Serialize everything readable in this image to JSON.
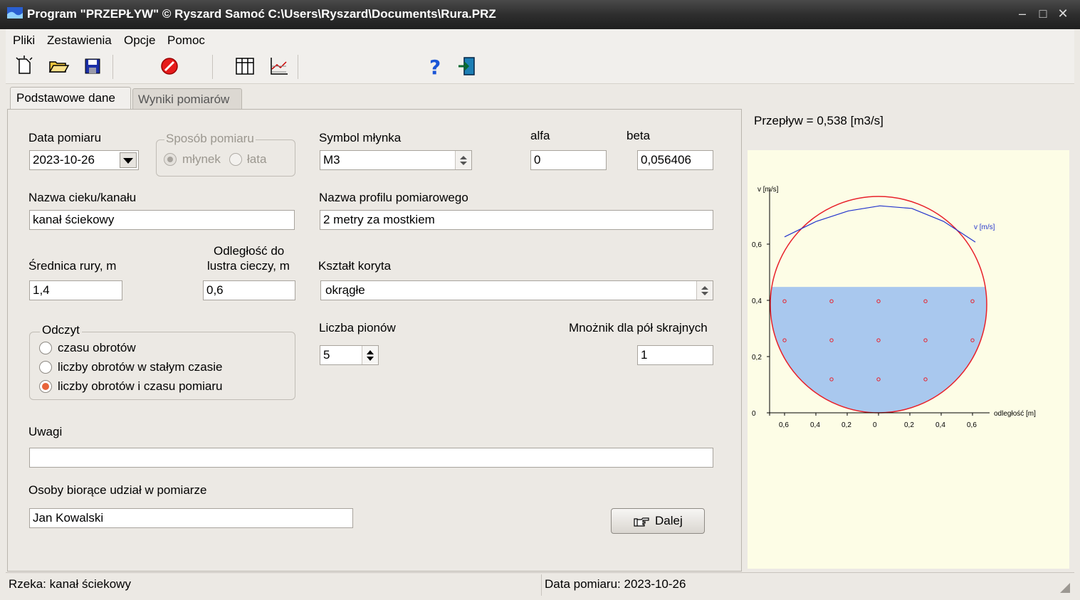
{
  "window": {
    "title": "Program \"PRZEPŁYW\" © Ryszard Samoć  C:\\Users\\Ryszard\\Documents\\Rura.PRZ"
  },
  "menu": [
    "Pliki",
    "Zestawienia",
    "Opcje",
    "Pomoc"
  ],
  "toolbar": [
    "new-icon",
    "open-icon",
    "save-icon",
    "stop-icon",
    "table-icon",
    "chart-icon",
    "help-icon",
    "exit-icon"
  ],
  "tabs": [
    "Podstawowe dane",
    "Wyniki pomiarów"
  ],
  "form": {
    "date_label": "Data pomiaru",
    "date_value": "2023-10-26",
    "method_legend": "Sposób pomiaru",
    "method_opt1": "młynek",
    "method_opt2": "łata",
    "symbol_label": "Symbol młynka",
    "symbol_value": "M3",
    "alfa_label": "alfa",
    "alfa_value": "0",
    "beta_label": "beta",
    "beta_value": "0,056406",
    "stream_label": "Nazwa cieku/kanału",
    "stream_value": "kanał ściekowy",
    "profile_label": "Nazwa profilu pomiarowego",
    "profile_value": "2 metry za mostkiem",
    "diameter_label": "Średnica rury, m",
    "diameter_value": "1,4",
    "distance_label1": "Odległość do",
    "distance_label2": "lustra cieczy, m",
    "distance_value": "0,6",
    "shape_label": "Kształt koryta",
    "shape_value": "okrągłe",
    "reading_legend": "Odczyt",
    "reading_opt1": "czasu obrotów",
    "reading_opt2": "liczby obrotów w stałym czasie",
    "reading_opt3": "liczby obrotów i czasu pomiaru",
    "verticals_label": "Liczba pionów",
    "verticals_value": "5",
    "mult_label": "Mnożnik dla pół skrajnych",
    "mult_value": "1",
    "notes_label": "Uwagi",
    "notes_value": "",
    "people_label": "Osoby biorące udział w pomiarze",
    "people_value": "Jan Kowalski",
    "next_button": "Dalej"
  },
  "flow_text": "Przepływ   = 0,538 [m3/s]",
  "status": {
    "left": "Rzeka: kanał ściekowy",
    "right": "Data pomiaru: 2023-10-26"
  },
  "chart_data": {
    "type": "line",
    "ylabel": "v [m/s]",
    "xlabel": "odległość [m]",
    "series_label": "v [m/s]",
    "x_ticks": [
      "0,6",
      "0,4",
      "0,2",
      "0",
      "0,2",
      "0,4",
      "0,6"
    ],
    "y_ticks": [
      "0",
      "0,2",
      "0,4",
      "0,6"
    ],
    "ylim": [
      0,
      0.8
    ],
    "xlim": [
      -0.7,
      0.7
    ],
    "pipe_diameter": 1.4,
    "water_level": 0.45,
    "velocity_x": [
      -0.6,
      -0.4,
      -0.2,
      0,
      0.2,
      0.4,
      0.6
    ],
    "velocity_y": [
      0.69,
      0.72,
      0.74,
      0.75,
      0.745,
      0.72,
      0.68
    ],
    "points": [
      {
        "x": -0.6,
        "y": 0.4
      },
      {
        "x": -0.3,
        "y": 0.4
      },
      {
        "x": 0,
        "y": 0.4
      },
      {
        "x": 0.3,
        "y": 0.4
      },
      {
        "x": 0.6,
        "y": 0.4
      },
      {
        "x": -0.6,
        "y": 0.26
      },
      {
        "x": -0.3,
        "y": 0.26
      },
      {
        "x": 0,
        "y": 0.26
      },
      {
        "x": 0.3,
        "y": 0.26
      },
      {
        "x": 0.6,
        "y": 0.26
      },
      {
        "x": -0.3,
        "y": 0.12
      },
      {
        "x": 0,
        "y": 0.12
      },
      {
        "x": 0.3,
        "y": 0.12
      }
    ],
    "colors": {
      "pipe": "#e8202a",
      "water": "#a9c8ee",
      "velocity": "#2233cc",
      "points": "#e8202a"
    }
  }
}
